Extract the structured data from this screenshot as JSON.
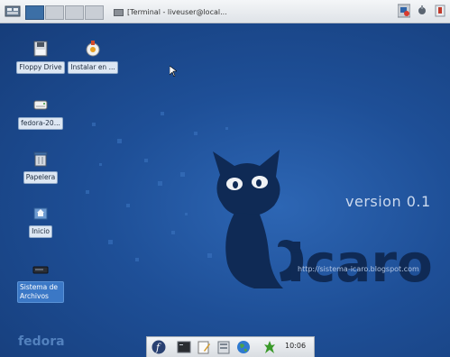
{
  "top_panel": {
    "taskbar_item": "[Terminal - liveuser@local..."
  },
  "desktop": {
    "icons": [
      {
        "label": "Floppy Drive"
      },
      {
        "label": "Instalar en ..."
      },
      {
        "label": "fedora-20..."
      },
      {
        "label": "Papelera"
      },
      {
        "label": "Inicio"
      },
      {
        "label": "Sistema de Archivos"
      }
    ],
    "branding": {
      "version": "version 0.1",
      "logo_text": "icaro",
      "url": "http://sistema-icaro.blogspot.com",
      "os_watermark": "fedora"
    }
  },
  "dock": {
    "clock": "10:06"
  },
  "colors": {
    "desktop_bg": "#1e4f97",
    "active_workspace": "#3c6fa6",
    "selection": "#3b78c6"
  }
}
